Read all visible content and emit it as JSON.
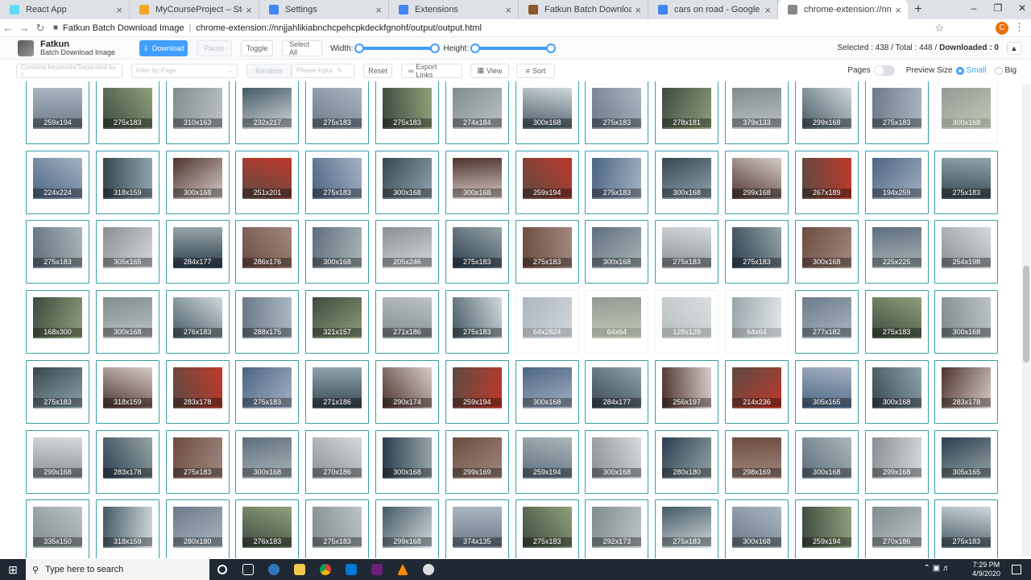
{
  "tabs": [
    {
      "title": "React App",
      "color": "#61dafb",
      "active": false
    },
    {
      "title": "MyCourseProject – Storage – Fire",
      "color": "#f5a623",
      "active": false
    },
    {
      "title": "Settings",
      "color": "#4285f4",
      "active": false
    },
    {
      "title": "Extensions",
      "color": "#4285f4",
      "active": false
    },
    {
      "title": "Fatkun Batch Download Image -",
      "color": "#8b5a2b",
      "active": false
    },
    {
      "title": "cars on road - Google Search",
      "color": "#4285f4",
      "active": false
    },
    {
      "title": "chrome-extension://nnjjahlikiabn",
      "color": "#888888",
      "active": true
    }
  ],
  "address": {
    "host": "Fatkun Batch Download Image",
    "url": "chrome-extension://nnjjahlikiabnchcpehcpkdeckfgnohf/output/output.html"
  },
  "header": {
    "brand_title": "Fatkun",
    "brand_subtitle": "Batch Download Image",
    "download": "Download",
    "pause": "Pause",
    "toggle": "Toggle",
    "select_all": "Select All",
    "width_label": "Width:",
    "height_label": "Height:",
    "selected_label": "Selected : 438 / Total : 448 / ",
    "downloaded_label": "Downloaded : 0"
  },
  "filters": {
    "keywords_placeholder": "Contains keywords(Separated by c",
    "page_placeholder": "Filter by Page",
    "rename": "Rename",
    "please_input": "Please Input",
    "reset": "Reset",
    "export_links": "Export Links",
    "view": "View",
    "sort": "Sort",
    "pages_label": "Pages",
    "preview_label": "Preview Size",
    "small": "Small",
    "big": "Big"
  },
  "images": [
    [
      "259x194",
      "275x183",
      "310x163",
      "232x217",
      "275x183",
      "275x183",
      "274x184",
      "300x168",
      "275x183",
      "278x181",
      "379x133",
      "299x168",
      "275x183",
      "300x168"
    ],
    [
      "224x224",
      "318x159",
      "300x168",
      "251x201",
      "275x183",
      "300x168",
      "300x168",
      "259x194",
      "275x183",
      "300x168",
      "299x168",
      "267x189",
      "194x259",
      "275x183"
    ],
    [
      "275x183",
      "305x165",
      "284x177",
      "286x176",
      "300x168",
      "205x246",
      "275x183",
      "275x183",
      "300x168",
      "275x183",
      "275x183",
      "300x168",
      "225x225",
      "254x198"
    ],
    [
      "168x300",
      "300x168",
      "276x183",
      "288x175",
      "321x157",
      "271x186",
      "275x183",
      "64x2824",
      "64x64",
      "128x128",
      "64x64",
      "277x182",
      "275x183",
      "300x168"
    ],
    [
      "275x183",
      "318x159",
      "283x178",
      "275x183",
      "271x186",
      "290x174",
      "259x194",
      "300x168",
      "284x177",
      "256x197",
      "214x236",
      "305x165",
      "300x168",
      "283x178"
    ],
    [
      "299x168",
      "283x178",
      "275x183",
      "300x168",
      "270x186",
      "300x168",
      "299x169",
      "259x194",
      "300x168",
      "280x180",
      "298x169",
      "300x168",
      "299x168",
      "305x165"
    ],
    [
      "335x150",
      "318x159",
      "280x180",
      "276x183",
      "275x183",
      "299x168",
      "374x135",
      "275x183",
      "292x173",
      "275x183",
      "300x168",
      "259x194",
      "270x186",
      "275x183"
    ]
  ],
  "faded": [
    [
      0,
      13
    ],
    [
      3,
      7
    ],
    [
      3,
      8
    ],
    [
      3,
      9
    ],
    [
      3,
      10
    ]
  ],
  "taskbar": {
    "search": "Type here to search",
    "time": "7:29 PM",
    "date": "4/9/2020"
  }
}
